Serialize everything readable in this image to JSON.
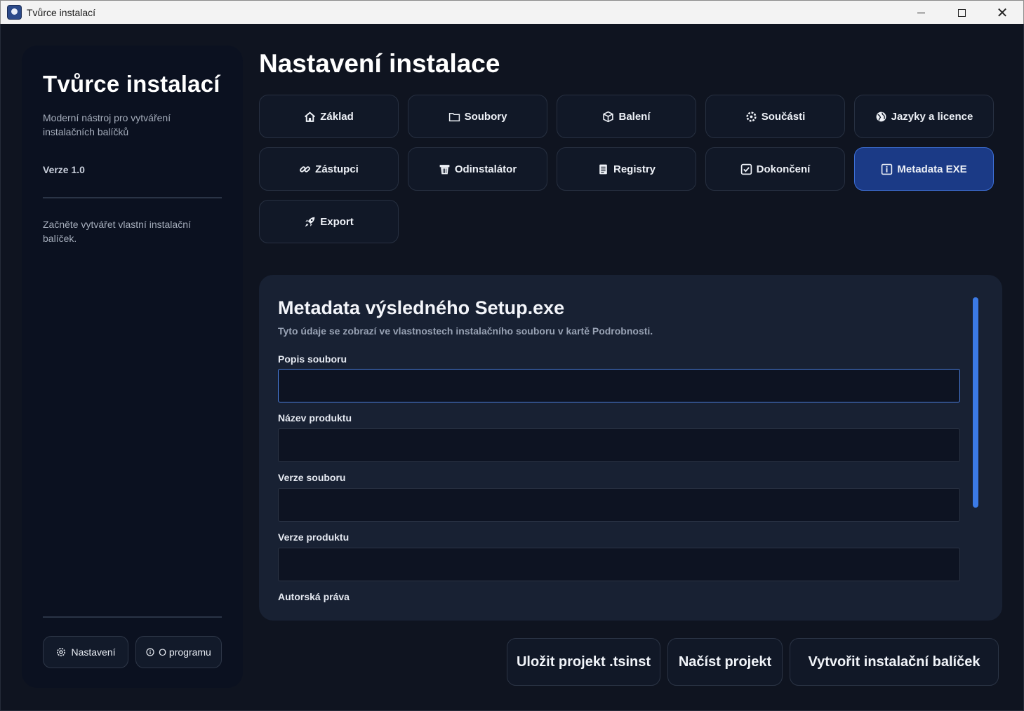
{
  "window": {
    "title": "Tvůrce instalací",
    "controls": [
      "minimize",
      "maximize",
      "close"
    ]
  },
  "sidebar": {
    "title": "Tvůrce instalací",
    "subtitle": "Moderní nástroj pro vytváření instalačních balíčků",
    "version": "Verze 1.0",
    "hint": "Začněte vytvářet vlastní instalační balíček.",
    "settings_label": "Nastavení",
    "about_label": "O programu"
  },
  "main": {
    "title": "Nastavení instalace",
    "tabs": [
      {
        "label": "Základ",
        "icon": "home-icon",
        "active": false
      },
      {
        "label": "Soubory",
        "icon": "folder-icon",
        "active": false
      },
      {
        "label": "Balení",
        "icon": "package-icon",
        "active": false
      },
      {
        "label": "Součásti",
        "icon": "puzzle-icon",
        "active": false
      },
      {
        "label": "Jazyky a licence",
        "icon": "globe-icon",
        "active": false
      },
      {
        "label": "Zástupci",
        "icon": "link-icon",
        "active": false
      },
      {
        "label": "Odinstalátor",
        "icon": "trash-icon",
        "active": false
      },
      {
        "label": "Registry",
        "icon": "document-icon",
        "active": false
      },
      {
        "label": "Dokončení",
        "icon": "checkbox-icon",
        "active": false
      },
      {
        "label": "Metadata EXE",
        "icon": "info-icon",
        "active": true
      },
      {
        "label": "Export",
        "icon": "rocket-icon",
        "active": false
      }
    ]
  },
  "card": {
    "title": "Metadata výsledného Setup.exe",
    "subtitle": "Tyto údaje se zobrazí ve vlastnostech instalačního souboru v kartě Podrobnosti.",
    "fields": [
      {
        "label": "Popis souboru",
        "value": ""
      },
      {
        "label": "Název produktu",
        "value": ""
      },
      {
        "label": "Verze souboru",
        "value": ""
      },
      {
        "label": "Verze produktu",
        "value": ""
      },
      {
        "label": "Autorská práva"
      }
    ]
  },
  "actions": {
    "save": "Uložit projekt .tsinst",
    "load": "Načíst projekt",
    "build": "Vytvořit instalační balíček"
  },
  "colors": {
    "background": "#0f1420",
    "sidebar": "#0b1120",
    "card": "#182133",
    "active_tab": "#1b3a86",
    "accent": "#3b7ae6"
  }
}
